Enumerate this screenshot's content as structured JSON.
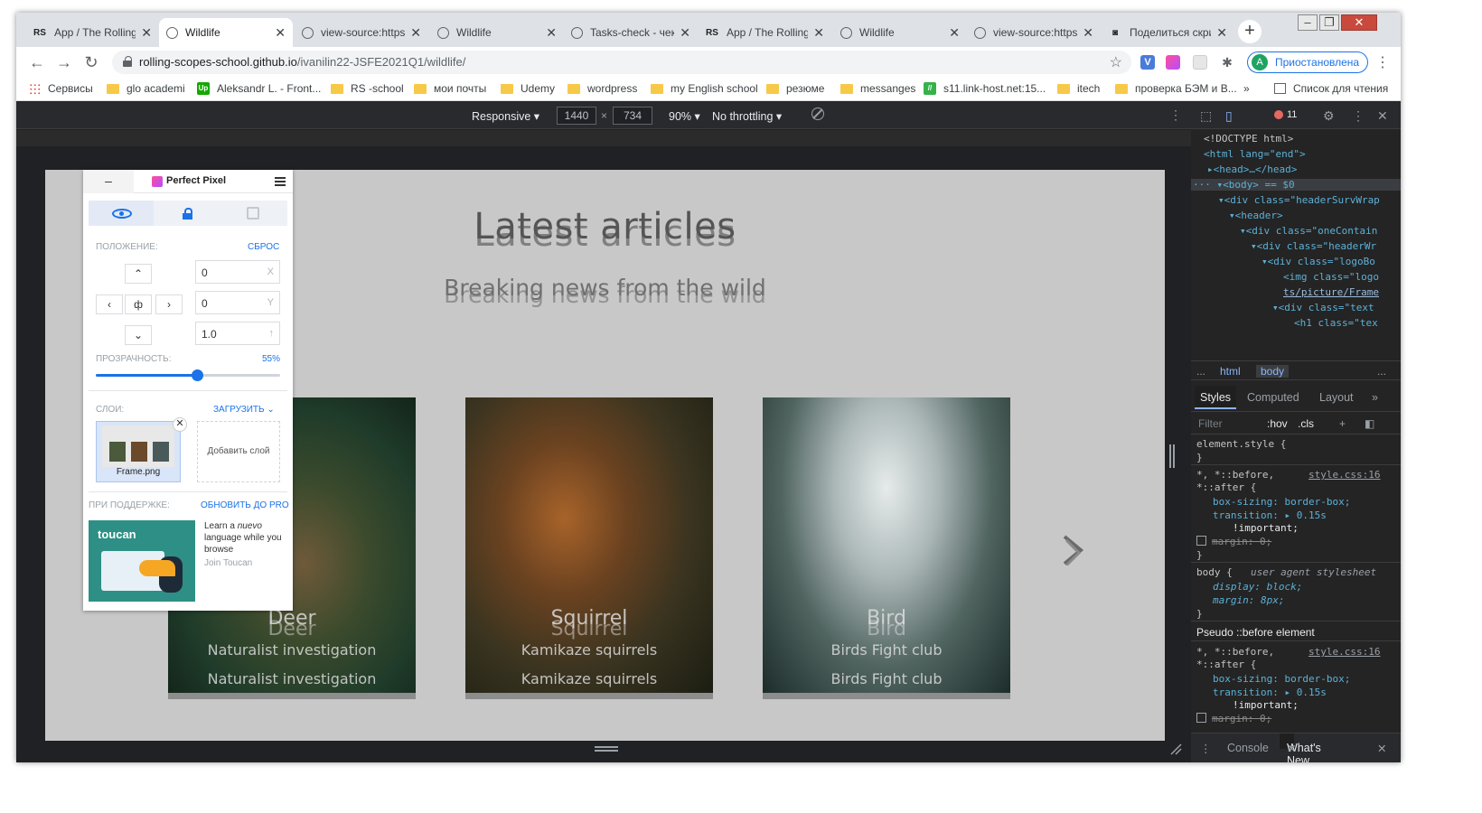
{
  "tabs": [
    {
      "label": "App / The Rolling",
      "icon": "RS"
    },
    {
      "label": "Wildlife",
      "icon": "globe",
      "active": true
    },
    {
      "label": "view-source:https:",
      "icon": "globe"
    },
    {
      "label": "Wildlife",
      "icon": "globe"
    },
    {
      "label": "Tasks-check - чек",
      "icon": "globe"
    },
    {
      "label": "App / The Rolling",
      "icon": "RS"
    },
    {
      "label": "Wildlife",
      "icon": "globe"
    },
    {
      "label": "view-source:https:",
      "icon": "globe"
    },
    {
      "label": "Поделиться скри",
      "icon": "camera"
    }
  ],
  "toolbar": {
    "url_host": "rolling-scopes-school.github.io",
    "url_path": "/ivanilin22-JSFE2021Q1/wildlife/",
    "profile_initial": "A",
    "profile_label": "Приостановлена"
  },
  "bookmarks": [
    {
      "label": "Сервисы",
      "icon": "apps"
    },
    {
      "label": "glo academi",
      "icon": "folder"
    },
    {
      "label": "Aleksandr L. - Front...",
      "icon": "upwork"
    },
    {
      "label": "RS -school",
      "icon": "folder"
    },
    {
      "label": "мои почты",
      "icon": "folder"
    },
    {
      "label": "Udemy",
      "icon": "folder"
    },
    {
      "label": "wordpress",
      "icon": "folder"
    },
    {
      "label": "my English school",
      "icon": "folder"
    },
    {
      "label": "резюме",
      "icon": "folder"
    },
    {
      "label": "messanges",
      "icon": "folder"
    },
    {
      "label": "s11.link-host.net:15...",
      "icon": "link"
    },
    {
      "label": "itech",
      "icon": "folder"
    },
    {
      "label": "проверка БЭМ и В...",
      "icon": "folder"
    }
  ],
  "bookmarks_more": "»",
  "reading_list": "Список для чтения",
  "device_toolbar": {
    "mode": "Responsive",
    "width": "1440",
    "height": "734",
    "times": "×",
    "zoom": "90%",
    "throttling": "No throttling"
  },
  "page": {
    "title": "Latest articles",
    "subtitle": "Breaking news from the wild",
    "cards": [
      {
        "name": "Deer",
        "desc": "Naturalist investigation"
      },
      {
        "name": "Squirrel",
        "desc": "Kamikaze squirrels"
      },
      {
        "name": "Bird",
        "desc": "Birds Fight club"
      }
    ]
  },
  "perfect_pixel": {
    "name": "Perfect Pixel",
    "minimize": "–",
    "position_label": "ПОЛОЖЕНИЕ:",
    "reset_label": "СБРОС",
    "x_value": "0",
    "x_axis": "X",
    "y_value": "0",
    "y_axis": "Y",
    "scale_value": "1.0",
    "scale_axis": "↑",
    "center_glyph": "ф",
    "opacity_label": "ПРОЗРАЧНОСТЬ:",
    "opacity_value": "55%",
    "opacity_fraction": 0.55,
    "layers_label": "СЛОИ:",
    "upload_label": "ЗАГРУЗИТЬ",
    "layer_file": "Frame.png",
    "add_layer": "Добавить слой",
    "support_label": "ПРИ ПОДДЕРЖКЕ:",
    "upgrade_label": "ОБНОВИТЬ ДО PRO",
    "promo_brand": "toucan",
    "promo_text_1": "Learn a",
    "promo_text_em": "nuevo",
    "promo_text_2": "language while you browse",
    "promo_join": "Join Toucan"
  },
  "devtools": {
    "error_count": "11",
    "breadcrumb_more": "...",
    "breadcrumbs": [
      "html",
      "body"
    ],
    "tabs": [
      "Styles",
      "Computed",
      "Layout",
      "»"
    ],
    "filter_placeholder": "Filter",
    "hov": ":hov",
    "cls": ".cls",
    "elements_code": [
      "<!DOCTYPE html>",
      "<html lang=\"end\">",
      "▸<head>…</head>",
      "··· ▾<body> == $0",
      "▾<div class=\"headerSurvWrap",
      "▾<header>",
      "▾<div class=\"oneContain",
      "▾<div class=\"headerWr",
      "▾<div class=\"logoBo",
      "<img class=\"logo",
      "ts/picture/Frame",
      "▾<div class=\"text",
      "<h1 class=\"tex"
    ],
    "styles_rules": {
      "element_style": "element.style {",
      "universal_sel": "*, *::before,",
      "universal_sel2": "*::after {",
      "source": "style.css:16",
      "box_sizing": "box-sizing: border-box;",
      "transition": "transition: ▸ 0.15s",
      "important": "!important;",
      "margin": "margin: 0;",
      "body_sel": "body {",
      "ua": "user agent stylesheet",
      "display": "display: block;",
      "body_margin": "margin: 8px;",
      "pseudo_header": "Pseudo ::before element",
      "close_brace": "}"
    },
    "drawer_tabs": [
      "Console",
      "What's New"
    ]
  }
}
